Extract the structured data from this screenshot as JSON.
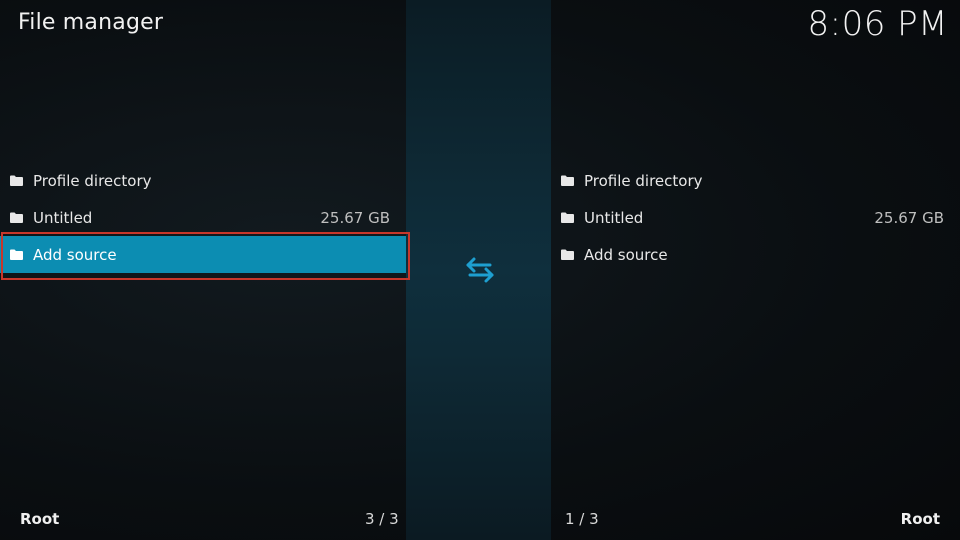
{
  "header": {
    "title": "File manager",
    "clock": "8:06 PM"
  },
  "left_pane": {
    "items": [
      {
        "label": "Profile directory",
        "size": "",
        "icon": "folder-icon"
      },
      {
        "label": "Untitled",
        "size": "25.67 GB",
        "icon": "folder-icon"
      },
      {
        "label": "Add source",
        "size": "",
        "icon": "folder-icon",
        "selected": true
      }
    ],
    "footer_path": "Root",
    "footer_count": "3 / 3"
  },
  "right_pane": {
    "items": [
      {
        "label": "Profile directory",
        "size": "",
        "icon": "folder-icon"
      },
      {
        "label": "Untitled",
        "size": "25.67 GB",
        "icon": "folder-icon"
      },
      {
        "label": "Add source",
        "size": "",
        "icon": "folder-icon"
      }
    ],
    "footer_count": "1 / 3",
    "footer_path": "Root"
  },
  "swap": {
    "icon": "swap-arrows-icon"
  },
  "colors": {
    "selection": "#0c8db2",
    "highlight_outline": "#c7372b",
    "swap_icon": "#1e9fd0"
  }
}
